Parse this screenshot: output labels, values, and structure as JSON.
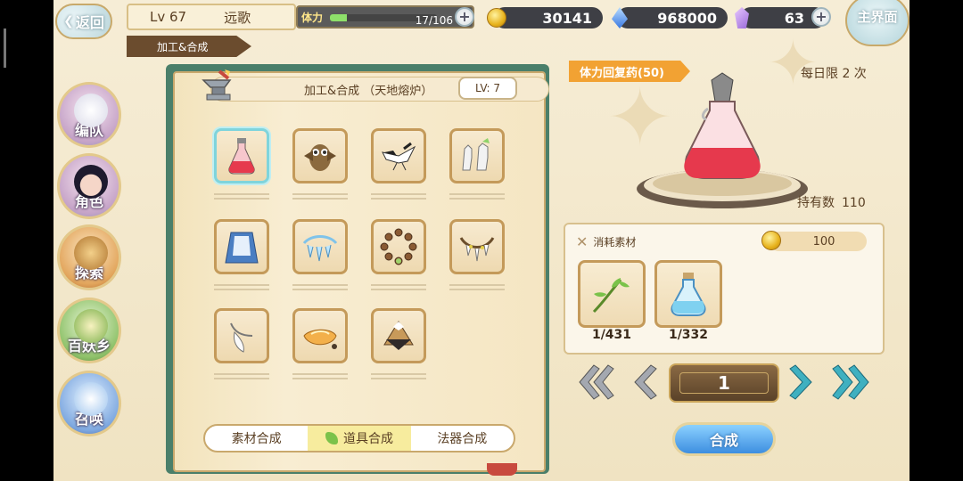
{
  "topbar": {
    "back_label": "返回",
    "level": "Lv 67",
    "player_name": "远歌",
    "breadcrumb": "加工&合成",
    "stamina_label": "体力",
    "stamina_value": "17/106",
    "stamina_fraction": 0.16,
    "gold": "30141",
    "gems": "968000",
    "crystals": "63",
    "home_label": "主界面"
  },
  "nav": {
    "items": [
      {
        "label": "编队"
      },
      {
        "label": "角色"
      },
      {
        "label": "探索"
      },
      {
        "label": "百妖乡"
      },
      {
        "label": "召唤"
      }
    ]
  },
  "book": {
    "title": "加工&合成 （天地熔炉）",
    "level_tag": "LV: 7",
    "items": [
      {
        "icon": "red-potion-icon"
      },
      {
        "icon": "owl-icon"
      },
      {
        "icon": "crane-icon"
      },
      {
        "icon": "white-gloves-icon"
      },
      {
        "icon": "blue-cloak-icon"
      },
      {
        "icon": "crystal-chain-icon"
      },
      {
        "icon": "prayer-beads-icon"
      },
      {
        "icon": "fang-necklace-icon"
      },
      {
        "icon": "tooth-pendant-icon"
      },
      {
        "icon": "amber-dish-icon"
      },
      {
        "icon": "fan-bundle-icon"
      }
    ],
    "tabs": [
      {
        "label": "素材合成",
        "active": false
      },
      {
        "label": "道具合成",
        "active": true
      },
      {
        "label": "法器合成",
        "active": false
      }
    ]
  },
  "detail": {
    "item_name": "体力回复药(50)",
    "daily_limit": "每日限 2 次",
    "owned_label": "持有数",
    "owned_value": "110",
    "materials_label": "消耗素材",
    "gold_cost": "100",
    "materials": [
      {
        "icon": "herb-icon",
        "count": "1/431"
      },
      {
        "icon": "blue-bottle-icon",
        "count": "1/332"
      }
    ],
    "quantity": "1",
    "craft_label": "合成"
  },
  "colors": {
    "accent_orange": "#f2a233",
    "craft_blue": "#3d8ee0",
    "frame_gold": "#c49a5a",
    "stamina_green": "#8ee06a"
  }
}
